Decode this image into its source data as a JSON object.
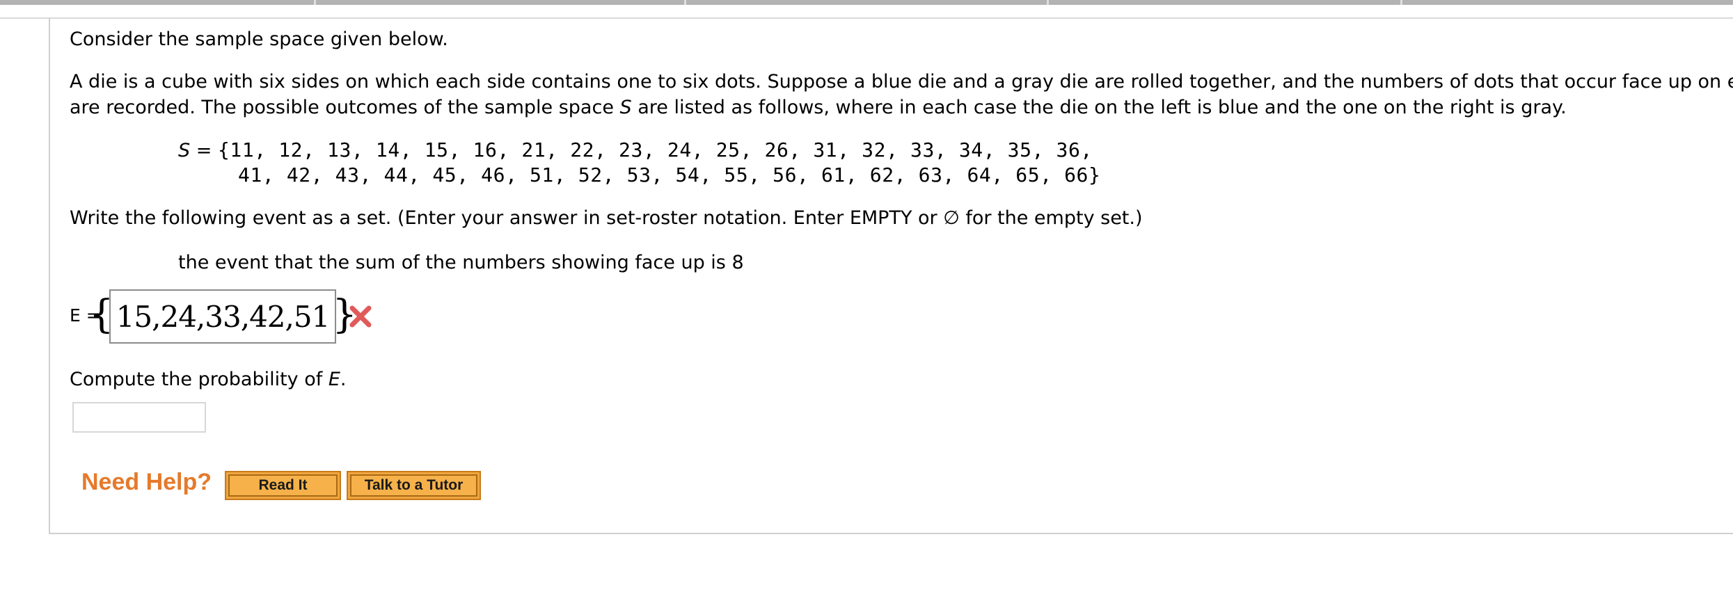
{
  "question": {
    "intro": "Consider the sample space given below.",
    "description_line1": "A die is a cube with six sides on which each side contains one to six dots. Suppose a blue die and a gray die are rolled together, and the numbers of dots that occur face up on each",
    "description_line2_before": "are recorded. The possible outcomes of the sample space ",
    "description_line2_symbol": "S",
    "description_line2_after": " are listed as follows, where in each case the die on the left is blue and the one on the right is gray.",
    "sample_space_symbol": "S",
    "sample_space_equals": " = ",
    "sample_space_line1": "{11, 12, 13, 14, 15, 16, 21, 22, 23, 24, 25, 26, 31, 32, 33, 34, 35, 36,",
    "sample_space_line2": "41, 42, 43, 44, 45, 46, 51, 52, 53, 54, 55, 56, 61, 62, 63, 64, 65, 66}",
    "instruction": "Write the following event as a set. (Enter your answer in set-roster notation. Enter EMPTY or ∅ for the empty set.)",
    "event_description": "the event that the sum of the numbers showing face up is 8"
  },
  "answer1": {
    "label": "E =",
    "open_brace": "{",
    "value": "15,24,33,42,51",
    "close_brace": "}",
    "status": "incorrect",
    "status_icon": "x-mark-icon",
    "status_color": "#e05a5a"
  },
  "part2": {
    "prompt_before": "Compute the probability of ",
    "prompt_symbol": "E",
    "prompt_after": ".",
    "input_value": ""
  },
  "help": {
    "label": "Need Help?",
    "read_it": "Read It",
    "talk_to_tutor": "Talk to a Tutor",
    "label_color": "#e57a2b",
    "button_color": "#f0a63f"
  }
}
